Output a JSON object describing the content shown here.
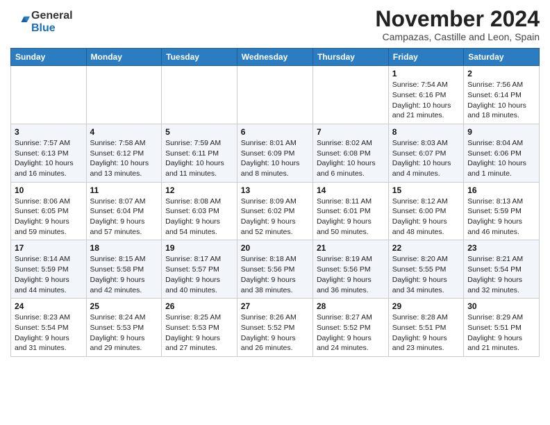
{
  "header": {
    "logo_general": "General",
    "logo_blue": "Blue",
    "month_title": "November 2024",
    "location": "Campazas, Castille and Leon, Spain"
  },
  "days_of_week": [
    "Sunday",
    "Monday",
    "Tuesday",
    "Wednesday",
    "Thursday",
    "Friday",
    "Saturday"
  ],
  "weeks": [
    [
      {
        "num": "",
        "info": ""
      },
      {
        "num": "",
        "info": ""
      },
      {
        "num": "",
        "info": ""
      },
      {
        "num": "",
        "info": ""
      },
      {
        "num": "",
        "info": ""
      },
      {
        "num": "1",
        "info": "Sunrise: 7:54 AM\nSunset: 6:16 PM\nDaylight: 10 hours\nand 21 minutes."
      },
      {
        "num": "2",
        "info": "Sunrise: 7:56 AM\nSunset: 6:14 PM\nDaylight: 10 hours\nand 18 minutes."
      }
    ],
    [
      {
        "num": "3",
        "info": "Sunrise: 7:57 AM\nSunset: 6:13 PM\nDaylight: 10 hours\nand 16 minutes."
      },
      {
        "num": "4",
        "info": "Sunrise: 7:58 AM\nSunset: 6:12 PM\nDaylight: 10 hours\nand 13 minutes."
      },
      {
        "num": "5",
        "info": "Sunrise: 7:59 AM\nSunset: 6:11 PM\nDaylight: 10 hours\nand 11 minutes."
      },
      {
        "num": "6",
        "info": "Sunrise: 8:01 AM\nSunset: 6:09 PM\nDaylight: 10 hours\nand 8 minutes."
      },
      {
        "num": "7",
        "info": "Sunrise: 8:02 AM\nSunset: 6:08 PM\nDaylight: 10 hours\nand 6 minutes."
      },
      {
        "num": "8",
        "info": "Sunrise: 8:03 AM\nSunset: 6:07 PM\nDaylight: 10 hours\nand 4 minutes."
      },
      {
        "num": "9",
        "info": "Sunrise: 8:04 AM\nSunset: 6:06 PM\nDaylight: 10 hours\nand 1 minute."
      }
    ],
    [
      {
        "num": "10",
        "info": "Sunrise: 8:06 AM\nSunset: 6:05 PM\nDaylight: 9 hours\nand 59 minutes."
      },
      {
        "num": "11",
        "info": "Sunrise: 8:07 AM\nSunset: 6:04 PM\nDaylight: 9 hours\nand 57 minutes."
      },
      {
        "num": "12",
        "info": "Sunrise: 8:08 AM\nSunset: 6:03 PM\nDaylight: 9 hours\nand 54 minutes."
      },
      {
        "num": "13",
        "info": "Sunrise: 8:09 AM\nSunset: 6:02 PM\nDaylight: 9 hours\nand 52 minutes."
      },
      {
        "num": "14",
        "info": "Sunrise: 8:11 AM\nSunset: 6:01 PM\nDaylight: 9 hours\nand 50 minutes."
      },
      {
        "num": "15",
        "info": "Sunrise: 8:12 AM\nSunset: 6:00 PM\nDaylight: 9 hours\nand 48 minutes."
      },
      {
        "num": "16",
        "info": "Sunrise: 8:13 AM\nSunset: 5:59 PM\nDaylight: 9 hours\nand 46 minutes."
      }
    ],
    [
      {
        "num": "17",
        "info": "Sunrise: 8:14 AM\nSunset: 5:59 PM\nDaylight: 9 hours\nand 44 minutes."
      },
      {
        "num": "18",
        "info": "Sunrise: 8:15 AM\nSunset: 5:58 PM\nDaylight: 9 hours\nand 42 minutes."
      },
      {
        "num": "19",
        "info": "Sunrise: 8:17 AM\nSunset: 5:57 PM\nDaylight: 9 hours\nand 40 minutes."
      },
      {
        "num": "20",
        "info": "Sunrise: 8:18 AM\nSunset: 5:56 PM\nDaylight: 9 hours\nand 38 minutes."
      },
      {
        "num": "21",
        "info": "Sunrise: 8:19 AM\nSunset: 5:56 PM\nDaylight: 9 hours\nand 36 minutes."
      },
      {
        "num": "22",
        "info": "Sunrise: 8:20 AM\nSunset: 5:55 PM\nDaylight: 9 hours\nand 34 minutes."
      },
      {
        "num": "23",
        "info": "Sunrise: 8:21 AM\nSunset: 5:54 PM\nDaylight: 9 hours\nand 32 minutes."
      }
    ],
    [
      {
        "num": "24",
        "info": "Sunrise: 8:23 AM\nSunset: 5:54 PM\nDaylight: 9 hours\nand 31 minutes."
      },
      {
        "num": "25",
        "info": "Sunrise: 8:24 AM\nSunset: 5:53 PM\nDaylight: 9 hours\nand 29 minutes."
      },
      {
        "num": "26",
        "info": "Sunrise: 8:25 AM\nSunset: 5:53 PM\nDaylight: 9 hours\nand 27 minutes."
      },
      {
        "num": "27",
        "info": "Sunrise: 8:26 AM\nSunset: 5:52 PM\nDaylight: 9 hours\nand 26 minutes."
      },
      {
        "num": "28",
        "info": "Sunrise: 8:27 AM\nSunset: 5:52 PM\nDaylight: 9 hours\nand 24 minutes."
      },
      {
        "num": "29",
        "info": "Sunrise: 8:28 AM\nSunset: 5:51 PM\nDaylight: 9 hours\nand 23 minutes."
      },
      {
        "num": "30",
        "info": "Sunrise: 8:29 AM\nSunset: 5:51 PM\nDaylight: 9 hours\nand 21 minutes."
      }
    ]
  ]
}
